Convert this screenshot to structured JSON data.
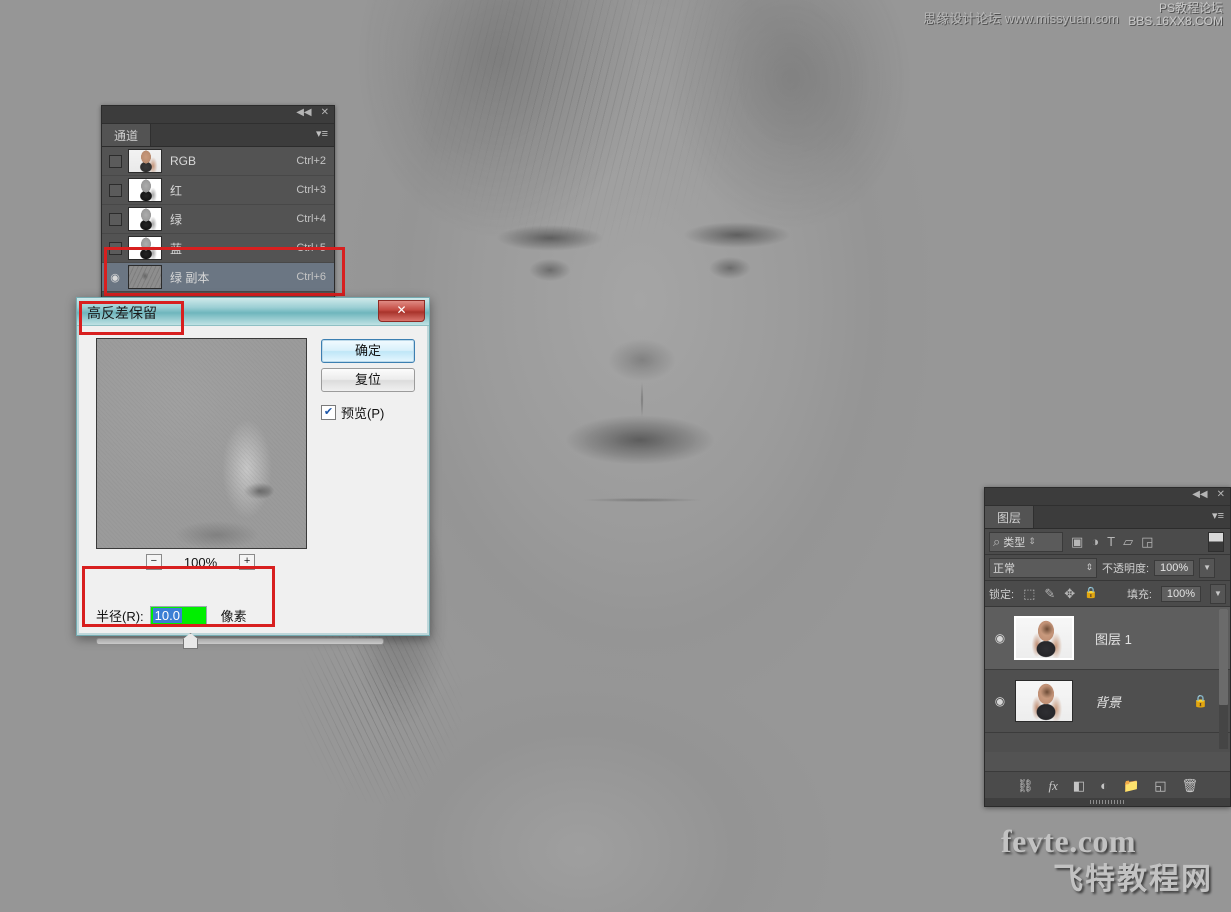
{
  "app": "Adobe Photoshop",
  "watermarks": {
    "top_left_text": "思缘设计论坛 www.missyuan.com",
    "top_right_line1": "PS教程论坛",
    "top_right_line2": "BBS.16XX8.COM",
    "bottom_line1": "fevte.com",
    "bottom_line2": "飞特教程网"
  },
  "channels_panel": {
    "tab_label": "通道",
    "collapse_icon": "◀◀",
    "close_icon": "✕",
    "menu_icon": "▾≡",
    "rows": [
      {
        "name": "RGB",
        "shortcut": "Ctrl+2",
        "visible": false,
        "selected": false,
        "thumb": "color"
      },
      {
        "name": "红",
        "shortcut": "Ctrl+3",
        "visible": false,
        "selected": false,
        "thumb": "gray"
      },
      {
        "name": "绿",
        "shortcut": "Ctrl+4",
        "visible": false,
        "selected": false,
        "thumb": "gray"
      },
      {
        "name": "蓝",
        "shortcut": "Ctrl+5",
        "visible": false,
        "selected": false,
        "thumb": "gray"
      },
      {
        "name": "绿 副本",
        "shortcut": "Ctrl+6",
        "visible": true,
        "selected": true,
        "thumb": "highpass"
      }
    ],
    "eye_icon": "◉"
  },
  "dialog": {
    "title": "高反差保留",
    "close_label": "✕",
    "ok_label": "确定",
    "reset_label": "复位",
    "preview_label": "预览(P)",
    "preview_checked": true,
    "check_glyph": "✔",
    "zoom_minus": "−",
    "zoom_plus": "+",
    "zoom_value": "100%",
    "radius_label": "半径(R):",
    "radius_value": "10.0",
    "radius_unit": "像素"
  },
  "layers_panel": {
    "tab_label": "图层",
    "collapse_icon": "◀◀",
    "close_icon": "✕",
    "menu_icon": "▾≡",
    "filter": {
      "search_icon": "⌕",
      "type_label": "类型",
      "stepper_icon": "⇕",
      "icons": [
        "image-filter-icon",
        "adjustment-filter-icon",
        "text-filter-icon",
        "shape-filter-icon",
        "smart-object-filter-icon"
      ],
      "icon_glyphs": [
        "▣",
        "◑",
        "T",
        "▱",
        "◲"
      ]
    },
    "blend_mode": "正常",
    "opacity_label": "不透明度:",
    "opacity_value": "100%",
    "lock_label": "锁定:",
    "lock_icons": [
      "⬚",
      "✎",
      "✥",
      "🔒"
    ],
    "fill_label": "填充:",
    "fill_value": "100%",
    "layers": [
      {
        "name": "图层 1",
        "visible": true,
        "selected": true,
        "locked": false,
        "italic": false
      },
      {
        "name": "背景",
        "visible": true,
        "selected": false,
        "locked": true,
        "italic": true
      }
    ],
    "eye_icon": "◉",
    "lock_glyph": "🔒",
    "bottom_icons": [
      "link-icon",
      "fx-icon",
      "layer-mask-icon",
      "adjustment-layer-icon",
      "new-group-icon",
      "new-layer-icon",
      "delete-layer-icon"
    ],
    "bottom_glyphs": [
      "⛓",
      "fx",
      "◧",
      "◐",
      "📁",
      "◱",
      "🗑"
    ]
  },
  "annotations": {
    "channel_row_box": "绿 副本 channel highlighted",
    "dialog_title_box": "高反差保留 title highlighted",
    "radius_box": "半径 radius value highlighted",
    "color": "#d81f1f"
  }
}
